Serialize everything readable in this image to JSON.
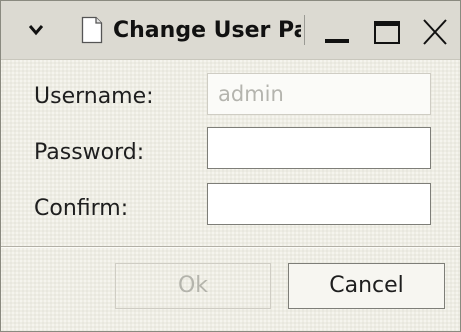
{
  "window": {
    "title": "Change User Password",
    "icons": {
      "menu": "chevron-down-icon",
      "document": "document-icon",
      "minimize": "minimize-icon",
      "maximize": "maximize-icon",
      "close": "close-icon"
    }
  },
  "form": {
    "username_label": "Username:",
    "username_value": "admin",
    "username_disabled": true,
    "password_label": "Password:",
    "password_value": "",
    "confirm_label": "Confirm:",
    "confirm_value": ""
  },
  "buttons": {
    "ok_label": "Ok",
    "ok_disabled": true,
    "cancel_label": "Cancel"
  }
}
